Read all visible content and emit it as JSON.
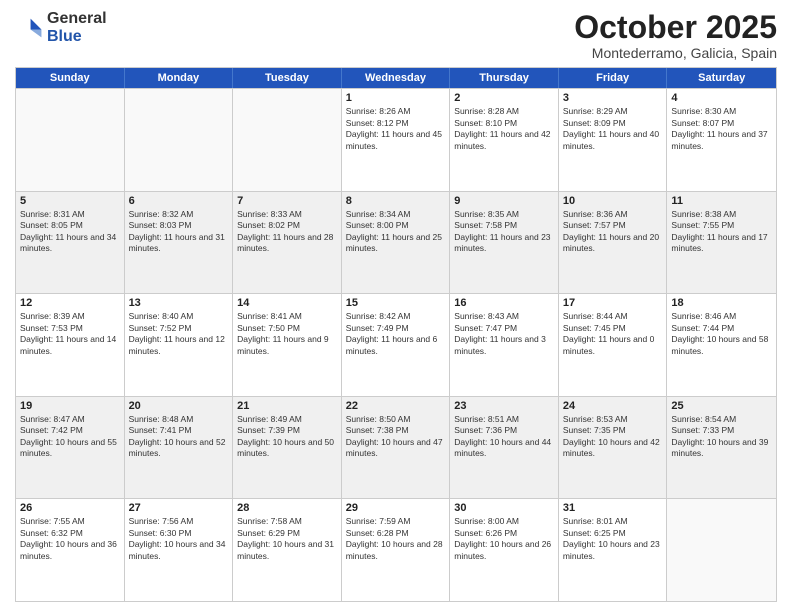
{
  "header": {
    "logo_general": "General",
    "logo_blue": "Blue",
    "month_title": "October 2025",
    "location": "Montederramo, Galicia, Spain"
  },
  "weekdays": [
    "Sunday",
    "Monday",
    "Tuesday",
    "Wednesday",
    "Thursday",
    "Friday",
    "Saturday"
  ],
  "weeks": [
    [
      {
        "day": "",
        "sunrise": "",
        "sunset": "",
        "daylight": ""
      },
      {
        "day": "",
        "sunrise": "",
        "sunset": "",
        "daylight": ""
      },
      {
        "day": "",
        "sunrise": "",
        "sunset": "",
        "daylight": ""
      },
      {
        "day": "1",
        "sunrise": "Sunrise: 8:26 AM",
        "sunset": "Sunset: 8:12 PM",
        "daylight": "Daylight: 11 hours and 45 minutes."
      },
      {
        "day": "2",
        "sunrise": "Sunrise: 8:28 AM",
        "sunset": "Sunset: 8:10 PM",
        "daylight": "Daylight: 11 hours and 42 minutes."
      },
      {
        "day": "3",
        "sunrise": "Sunrise: 8:29 AM",
        "sunset": "Sunset: 8:09 PM",
        "daylight": "Daylight: 11 hours and 40 minutes."
      },
      {
        "day": "4",
        "sunrise": "Sunrise: 8:30 AM",
        "sunset": "Sunset: 8:07 PM",
        "daylight": "Daylight: 11 hours and 37 minutes."
      }
    ],
    [
      {
        "day": "5",
        "sunrise": "Sunrise: 8:31 AM",
        "sunset": "Sunset: 8:05 PM",
        "daylight": "Daylight: 11 hours and 34 minutes."
      },
      {
        "day": "6",
        "sunrise": "Sunrise: 8:32 AM",
        "sunset": "Sunset: 8:03 PM",
        "daylight": "Daylight: 11 hours and 31 minutes."
      },
      {
        "day": "7",
        "sunrise": "Sunrise: 8:33 AM",
        "sunset": "Sunset: 8:02 PM",
        "daylight": "Daylight: 11 hours and 28 minutes."
      },
      {
        "day": "8",
        "sunrise": "Sunrise: 8:34 AM",
        "sunset": "Sunset: 8:00 PM",
        "daylight": "Daylight: 11 hours and 25 minutes."
      },
      {
        "day": "9",
        "sunrise": "Sunrise: 8:35 AM",
        "sunset": "Sunset: 7:58 PM",
        "daylight": "Daylight: 11 hours and 23 minutes."
      },
      {
        "day": "10",
        "sunrise": "Sunrise: 8:36 AM",
        "sunset": "Sunset: 7:57 PM",
        "daylight": "Daylight: 11 hours and 20 minutes."
      },
      {
        "day": "11",
        "sunrise": "Sunrise: 8:38 AM",
        "sunset": "Sunset: 7:55 PM",
        "daylight": "Daylight: 11 hours and 17 minutes."
      }
    ],
    [
      {
        "day": "12",
        "sunrise": "Sunrise: 8:39 AM",
        "sunset": "Sunset: 7:53 PM",
        "daylight": "Daylight: 11 hours and 14 minutes."
      },
      {
        "day": "13",
        "sunrise": "Sunrise: 8:40 AM",
        "sunset": "Sunset: 7:52 PM",
        "daylight": "Daylight: 11 hours and 12 minutes."
      },
      {
        "day": "14",
        "sunrise": "Sunrise: 8:41 AM",
        "sunset": "Sunset: 7:50 PM",
        "daylight": "Daylight: 11 hours and 9 minutes."
      },
      {
        "day": "15",
        "sunrise": "Sunrise: 8:42 AM",
        "sunset": "Sunset: 7:49 PM",
        "daylight": "Daylight: 11 hours and 6 minutes."
      },
      {
        "day": "16",
        "sunrise": "Sunrise: 8:43 AM",
        "sunset": "Sunset: 7:47 PM",
        "daylight": "Daylight: 11 hours and 3 minutes."
      },
      {
        "day": "17",
        "sunrise": "Sunrise: 8:44 AM",
        "sunset": "Sunset: 7:45 PM",
        "daylight": "Daylight: 11 hours and 0 minutes."
      },
      {
        "day": "18",
        "sunrise": "Sunrise: 8:46 AM",
        "sunset": "Sunset: 7:44 PM",
        "daylight": "Daylight: 10 hours and 58 minutes."
      }
    ],
    [
      {
        "day": "19",
        "sunrise": "Sunrise: 8:47 AM",
        "sunset": "Sunset: 7:42 PM",
        "daylight": "Daylight: 10 hours and 55 minutes."
      },
      {
        "day": "20",
        "sunrise": "Sunrise: 8:48 AM",
        "sunset": "Sunset: 7:41 PM",
        "daylight": "Daylight: 10 hours and 52 minutes."
      },
      {
        "day": "21",
        "sunrise": "Sunrise: 8:49 AM",
        "sunset": "Sunset: 7:39 PM",
        "daylight": "Daylight: 10 hours and 50 minutes."
      },
      {
        "day": "22",
        "sunrise": "Sunrise: 8:50 AM",
        "sunset": "Sunset: 7:38 PM",
        "daylight": "Daylight: 10 hours and 47 minutes."
      },
      {
        "day": "23",
        "sunrise": "Sunrise: 8:51 AM",
        "sunset": "Sunset: 7:36 PM",
        "daylight": "Daylight: 10 hours and 44 minutes."
      },
      {
        "day": "24",
        "sunrise": "Sunrise: 8:53 AM",
        "sunset": "Sunset: 7:35 PM",
        "daylight": "Daylight: 10 hours and 42 minutes."
      },
      {
        "day": "25",
        "sunrise": "Sunrise: 8:54 AM",
        "sunset": "Sunset: 7:33 PM",
        "daylight": "Daylight: 10 hours and 39 minutes."
      }
    ],
    [
      {
        "day": "26",
        "sunrise": "Sunrise: 7:55 AM",
        "sunset": "Sunset: 6:32 PM",
        "daylight": "Daylight: 10 hours and 36 minutes."
      },
      {
        "day": "27",
        "sunrise": "Sunrise: 7:56 AM",
        "sunset": "Sunset: 6:30 PM",
        "daylight": "Daylight: 10 hours and 34 minutes."
      },
      {
        "day": "28",
        "sunrise": "Sunrise: 7:58 AM",
        "sunset": "Sunset: 6:29 PM",
        "daylight": "Daylight: 10 hours and 31 minutes."
      },
      {
        "day": "29",
        "sunrise": "Sunrise: 7:59 AM",
        "sunset": "Sunset: 6:28 PM",
        "daylight": "Daylight: 10 hours and 28 minutes."
      },
      {
        "day": "30",
        "sunrise": "Sunrise: 8:00 AM",
        "sunset": "Sunset: 6:26 PM",
        "daylight": "Daylight: 10 hours and 26 minutes."
      },
      {
        "day": "31",
        "sunrise": "Sunrise: 8:01 AM",
        "sunset": "Sunset: 6:25 PM",
        "daylight": "Daylight: 10 hours and 23 minutes."
      },
      {
        "day": "",
        "sunrise": "",
        "sunset": "",
        "daylight": ""
      }
    ]
  ]
}
